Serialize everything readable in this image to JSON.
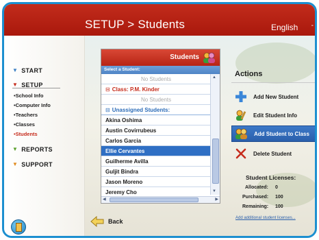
{
  "header": {
    "title": "SETUP > Students",
    "language": "English",
    "language_caret": "-"
  },
  "sidebar": {
    "sections": [
      {
        "label": "START"
      },
      {
        "label": "SETUP"
      },
      {
        "label": "REPORTS"
      },
      {
        "label": "SUPPORT"
      }
    ],
    "setup_items": [
      {
        "label": "•School Info"
      },
      {
        "label": "•Computer Info"
      },
      {
        "label": "•Teachers"
      },
      {
        "label": "•Classes"
      },
      {
        "label": "•Students"
      }
    ]
  },
  "panel": {
    "header_label": "Students",
    "select_label": "Select a Student:",
    "rows": [
      {
        "text": "No Students"
      },
      {
        "box": "⊟",
        "text": "Class: P.M. Kinder"
      },
      {
        "text": "No Students"
      },
      {
        "box": "⊟",
        "text": "Unassigned Students:"
      },
      {
        "text": "Akina Oshima"
      },
      {
        "text": "Austin Covirrubeus"
      },
      {
        "text": "Carlos Garcia"
      },
      {
        "text": "Ellie Cervantes"
      },
      {
        "text": "Guilherme Avilla"
      },
      {
        "text": "Guljit Bindra"
      },
      {
        "text": "Jason Moreno"
      },
      {
        "text": "Jeremy  Cho"
      }
    ]
  },
  "actions": {
    "title": "Actions",
    "items": [
      {
        "label": "Add New Student",
        "icon": "plus-icon"
      },
      {
        "label": "Edit Student Info",
        "icon": "edit-person-icon"
      },
      {
        "label": "Add Student to Class",
        "icon": "group-add-icon"
      },
      {
        "label": "Delete Student",
        "icon": "delete-x-icon"
      }
    ]
  },
  "licenses": {
    "title": "Student Licenses:",
    "allocated_label": "Allocated:",
    "allocated_value": "0",
    "purchased_label": "Purchased:",
    "purchased_value": "100",
    "remaining_label": "Remaining:",
    "remaining_value": "100",
    "link": "Add additional student licenses..."
  },
  "back_label": "Back",
  "colors": {
    "header_red": "#b72414",
    "frame_blue": "#1c8fd0",
    "selection_blue": "#2f6fc4"
  }
}
